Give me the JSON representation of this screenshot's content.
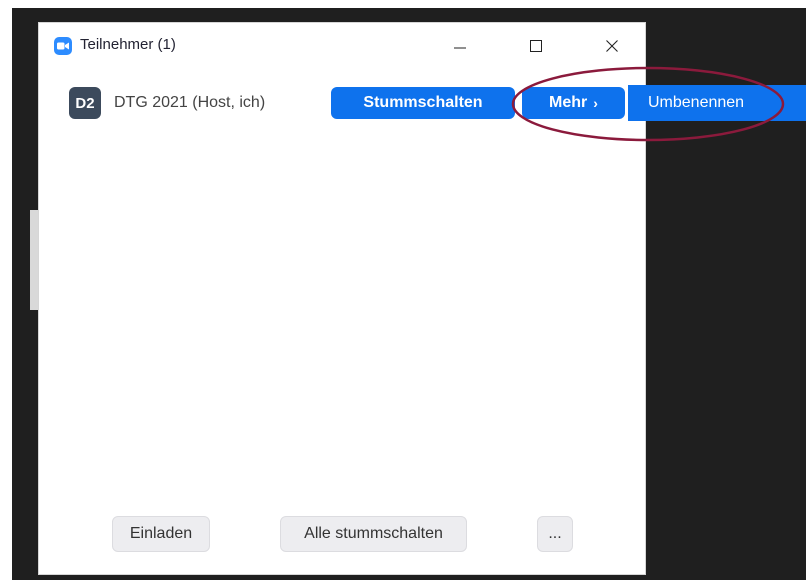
{
  "window": {
    "title": "Teilnehmer (1)",
    "controls": [
      "minimize",
      "maximize",
      "close"
    ]
  },
  "participant": {
    "initials": "D2",
    "name": "DTG 2021 (Host, ich)",
    "mute_label": "Stummschalten",
    "more_label": "Mehr",
    "more_chevron": "›"
  },
  "more_menu": {
    "items": [
      {
        "label": "Umbenennen",
        "selected": true
      }
    ]
  },
  "footer": {
    "invite_label": "Einladen",
    "mute_all_label": "Alle stummschalten",
    "more_options_label": "..."
  },
  "colors": {
    "accent": "#0e72ed",
    "avatar_bg": "#3c4a5c",
    "annotation": "#8b1a3c",
    "dark_background": "#1f1f1f"
  }
}
